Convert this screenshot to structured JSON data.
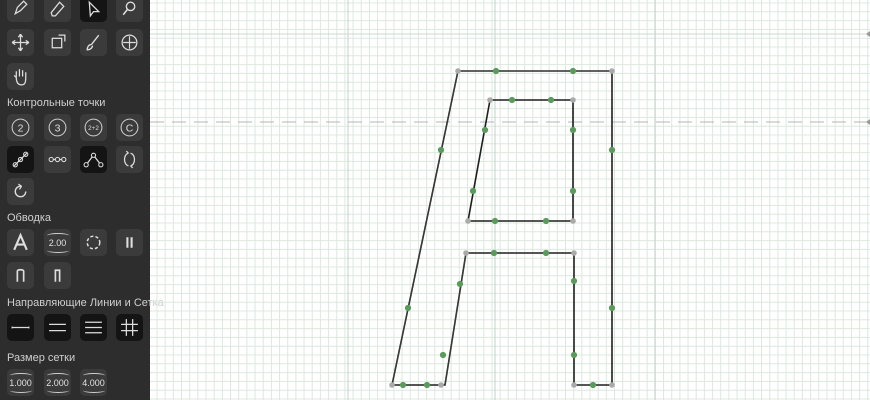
{
  "sidebar": {
    "control_points_title": "Контрольные точки",
    "stroke_title": "Обводка",
    "guides_title": "Направляющие Линии и Сетка",
    "grid_size_title": "Размер сетки",
    "point_buttons": [
      "2",
      "3",
      "2+2",
      "C"
    ],
    "stroke_width_value": "2.00",
    "grid_sizes": [
      "1.000",
      "2.000",
      "4.000"
    ]
  },
  "tools": [
    "pen-tool",
    "eraser-tool",
    "select-arrow-tool",
    "zoom-tool",
    "move-tool",
    "resize-tool",
    "brush-tool",
    "pan-compass-tool",
    "hand-tool"
  ],
  "colors": {
    "sidebar": "#2d2d2d",
    "button": "#3b3b3b",
    "point": "#5a9a5a",
    "corner_point": "#aaaaaa",
    "grid": "#dce8de"
  }
}
